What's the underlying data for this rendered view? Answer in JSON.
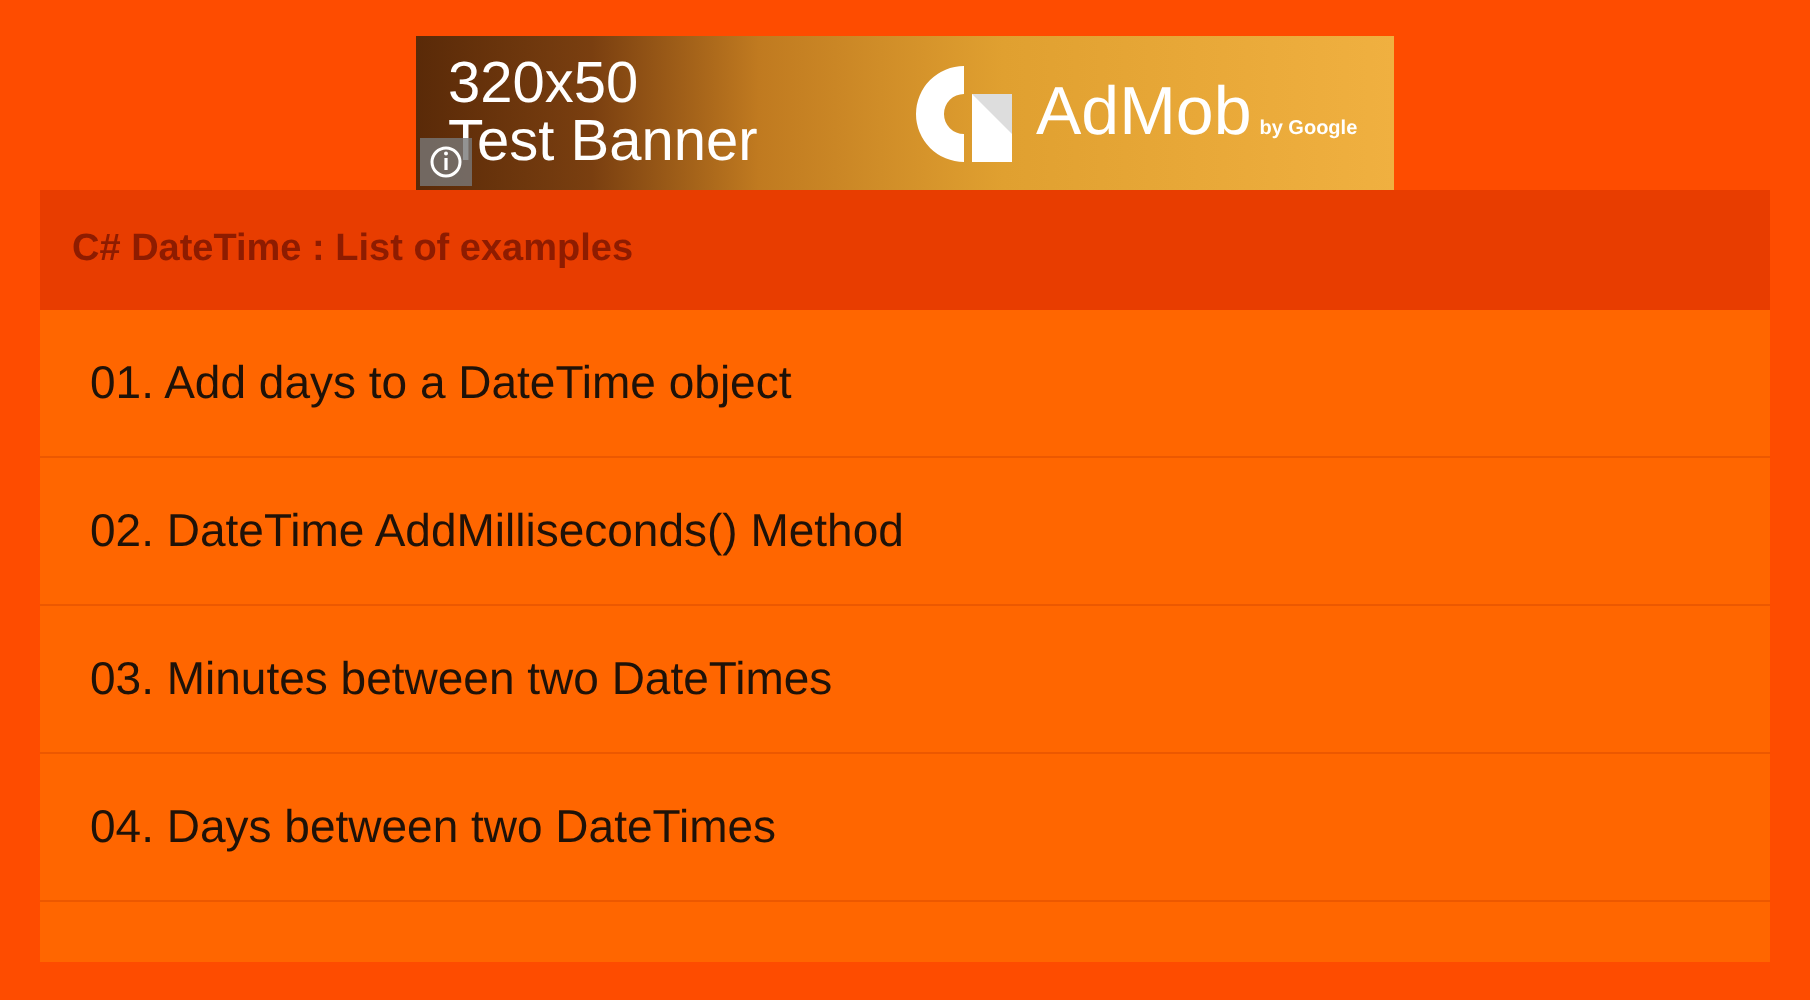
{
  "ad_banner": {
    "size": "320x50",
    "label": "Test Banner",
    "brand": "AdMob",
    "byline": "by Google"
  },
  "list": {
    "title": "C# DateTime : List of examples",
    "items": [
      {
        "label": "01. Add days to a DateTime object"
      },
      {
        "label": "02. DateTime AddMilliseconds() Method"
      },
      {
        "label": "03. Minutes between two DateTimes"
      },
      {
        "label": "04. Days between two DateTimes"
      }
    ]
  }
}
